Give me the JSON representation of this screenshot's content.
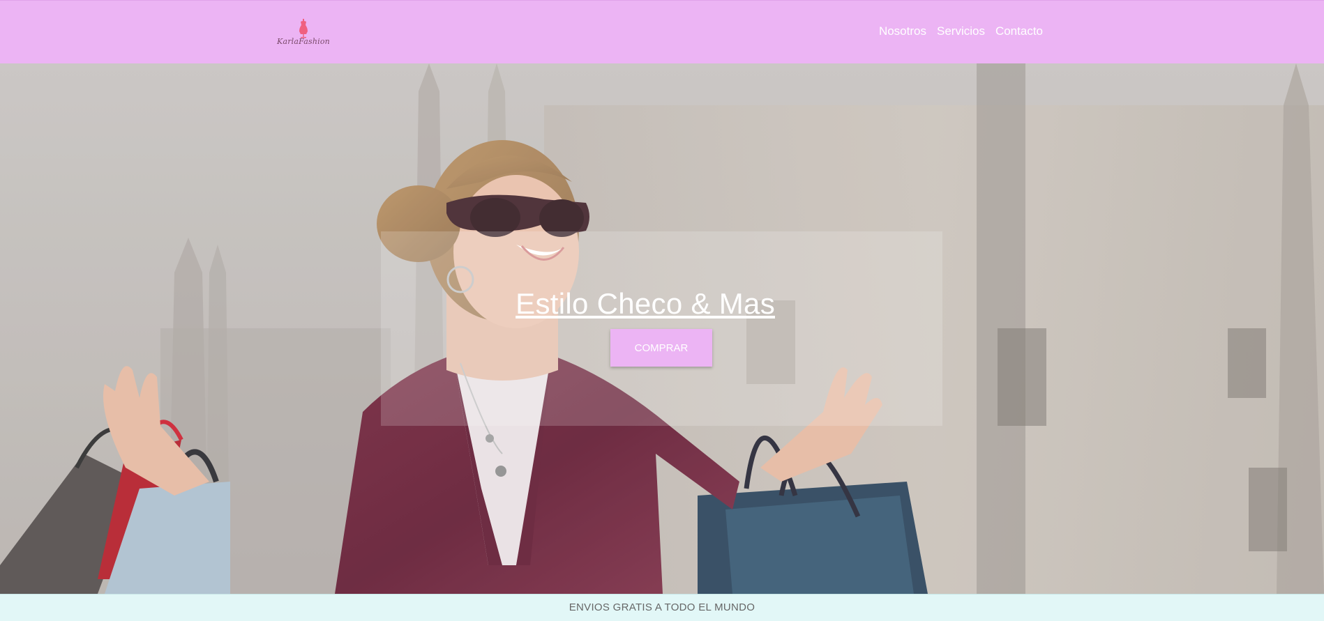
{
  "header": {
    "logo_text": "KarlaFashion",
    "logo_icon": "dress-form-icon",
    "nav": [
      {
        "label": "Nosotros"
      },
      {
        "label": "Servicios"
      },
      {
        "label": "Contacto"
      }
    ]
  },
  "hero": {
    "title": "Estilo Checo & Mas",
    "button_label": "COMPRAR",
    "background_image": "woman-with-shopping-bags-photo"
  },
  "banner": {
    "text": "ENVIOS GRATIS A TODO EL MUNDO"
  },
  "colors": {
    "accent": "#ecb4f4",
    "banner_bg": "#e2f7f7",
    "logo_icon": "#f06080"
  }
}
